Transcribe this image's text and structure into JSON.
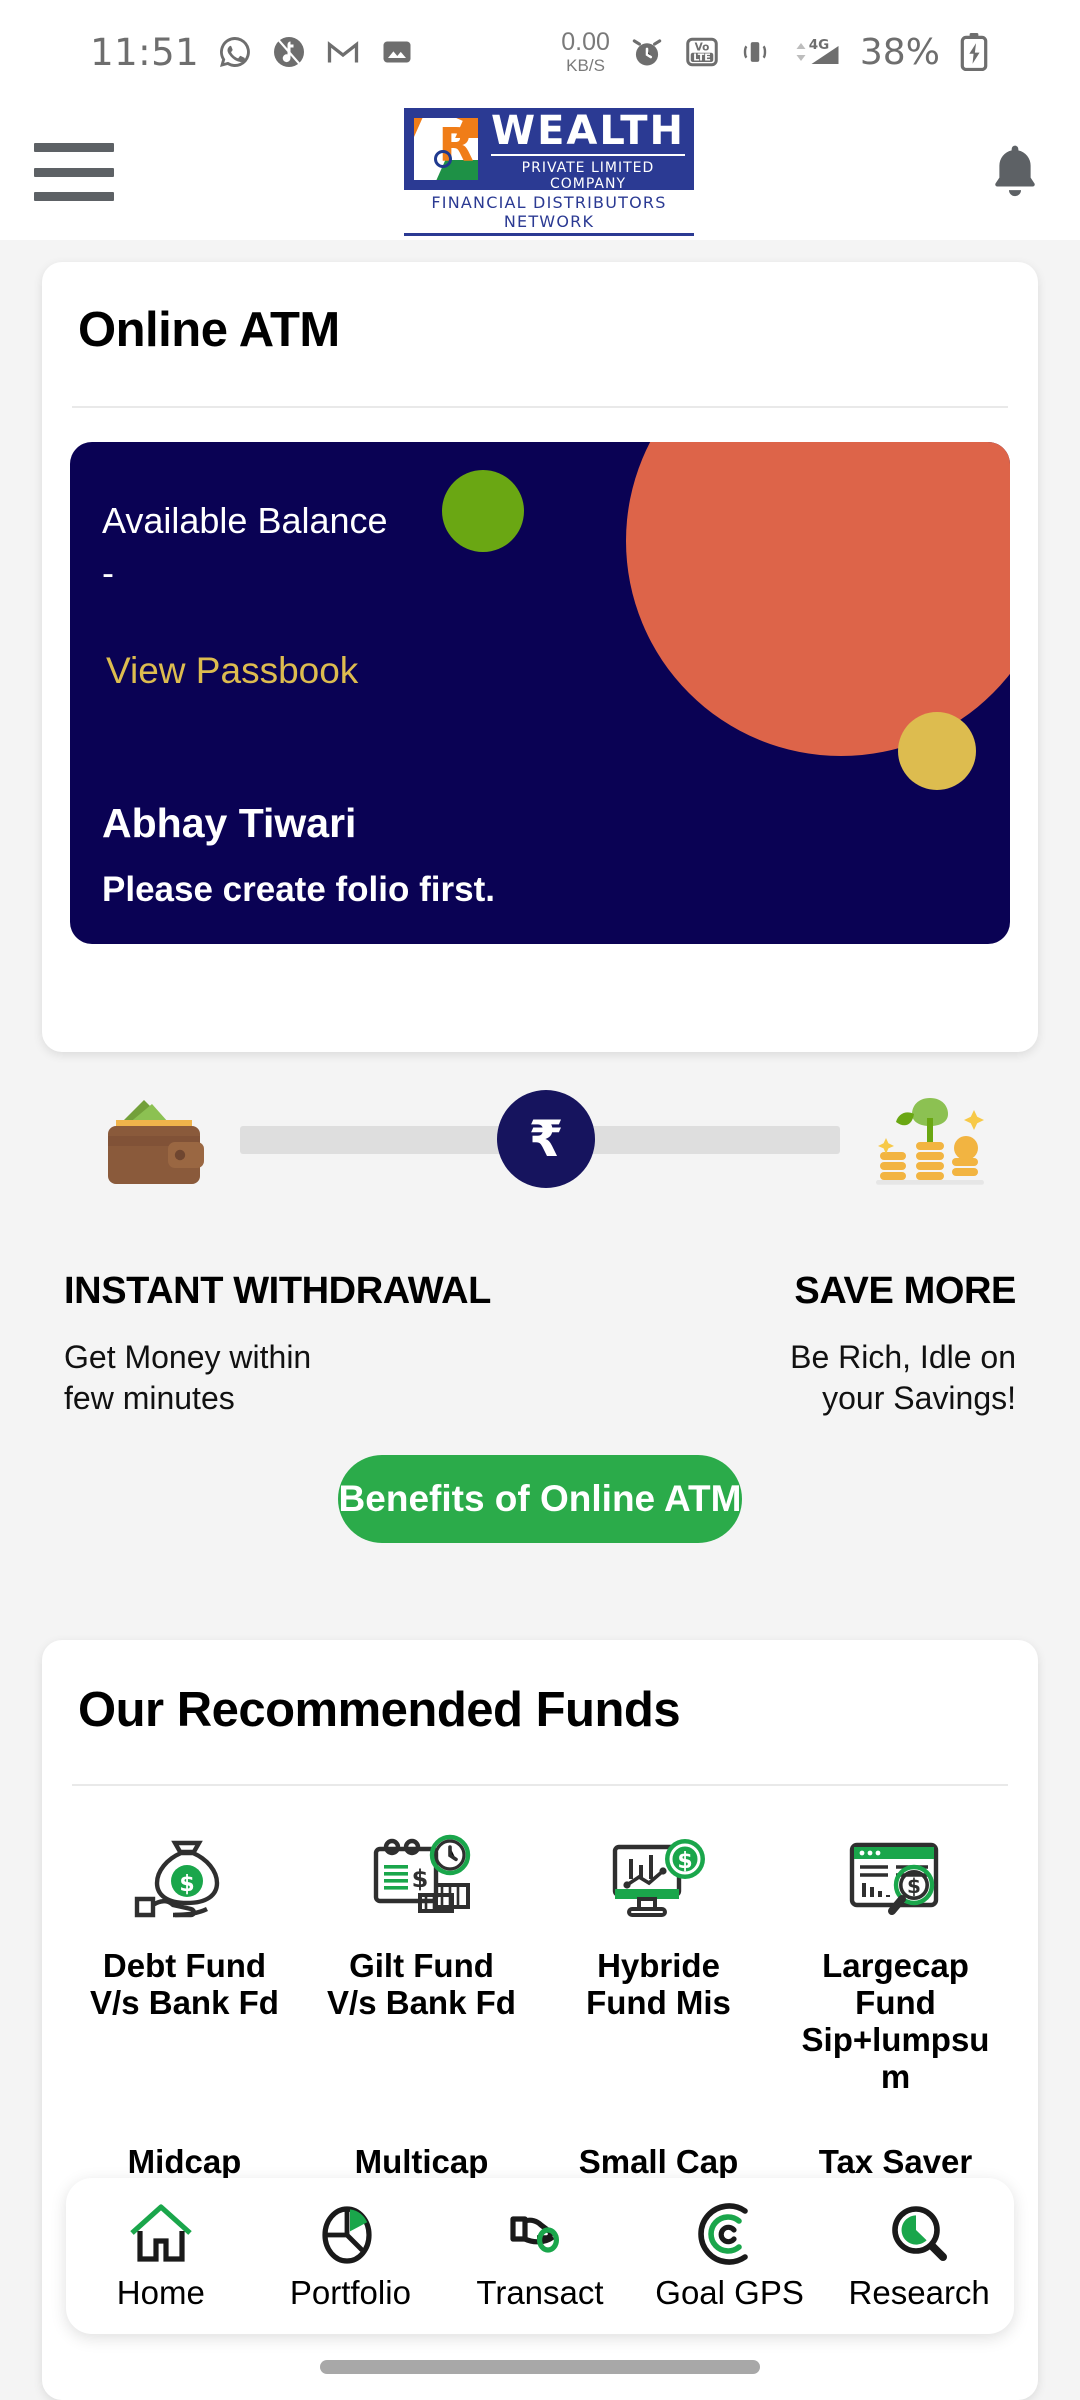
{
  "status_bar": {
    "time": "11:51",
    "icons": [
      "whatsapp-icon",
      "silent-mode-icon",
      "gmail-icon",
      "photos-icon"
    ],
    "data_rate_value": "0.00",
    "data_rate_unit": "KB/S",
    "right_icons": [
      "alarm-icon",
      "volte-icon",
      "vibrate-icon",
      "4g-signal-icon"
    ],
    "battery_percent": "38%"
  },
  "header": {
    "menu_icon": "hamburger-menu-icon",
    "logo": {
      "word": "WEALTH",
      "subtitle": "PRIVATE LIMITED COMPANY",
      "network": "FINANCIAL DISTRIBUTORS NETWORK",
      "mark_letter": "R"
    },
    "notification_icon": "bell-icon"
  },
  "atm_card": {
    "title": "Online ATM",
    "balance_label": "Available Balance",
    "balance_value": "-",
    "passbook_link": "View Passbook",
    "user_name": "Abhay Tiwari",
    "folio_message": "Please create folio first.",
    "colors": {
      "card_bg": "#0a0254",
      "blob_salmon": "#dd6449",
      "blob_green": "#6aa713",
      "blob_gold": "#ddbc4f",
      "link": "#ddbc4f"
    },
    "slider": {
      "left_icon": "wallet-cash-icon",
      "knob_symbol": "₹",
      "right_icon": "money-plant-growth-icon"
    },
    "left_caption": {
      "heading": "INSTANT WITHDRAWAL",
      "text": "Get Money within\nfew minutes"
    },
    "right_caption": {
      "heading": "SAVE MORE",
      "text": "Be Rich, Idle on\nyour Savings!"
    },
    "cta_label": "Benefits of Online ATM",
    "cta_color": "#2bab4a"
  },
  "funds_card": {
    "title": "Our Recommended Funds",
    "items": [
      {
        "label": "Debt Fund V/s Bank Fd",
        "icon": "money-bag-hand-icon"
      },
      {
        "label": "Gilt Fund V/s Bank Fd",
        "icon": "calendar-clock-money-icon"
      },
      {
        "label": "Hybride Fund Mis",
        "icon": "monitor-chart-dollar-icon"
      },
      {
        "label": "Largecap Fund Sip+lumpsum",
        "icon": "browser-chart-search-icon"
      }
    ],
    "partial_row": [
      "Midcap",
      "Multicap",
      "Small Cap",
      "Tax Saver"
    ]
  },
  "bottom_nav": {
    "items": [
      {
        "label": "Home",
        "icon": "home-icon",
        "active": true
      },
      {
        "label": "Portfolio",
        "icon": "pie-chart-icon",
        "active": false
      },
      {
        "label": "Transact",
        "icon": "hand-coin-icon",
        "active": false
      },
      {
        "label": "Goal GPS",
        "icon": "radar-signal-icon",
        "active": false
      },
      {
        "label": "Research",
        "icon": "magnifier-pie-icon",
        "active": false
      }
    ]
  }
}
